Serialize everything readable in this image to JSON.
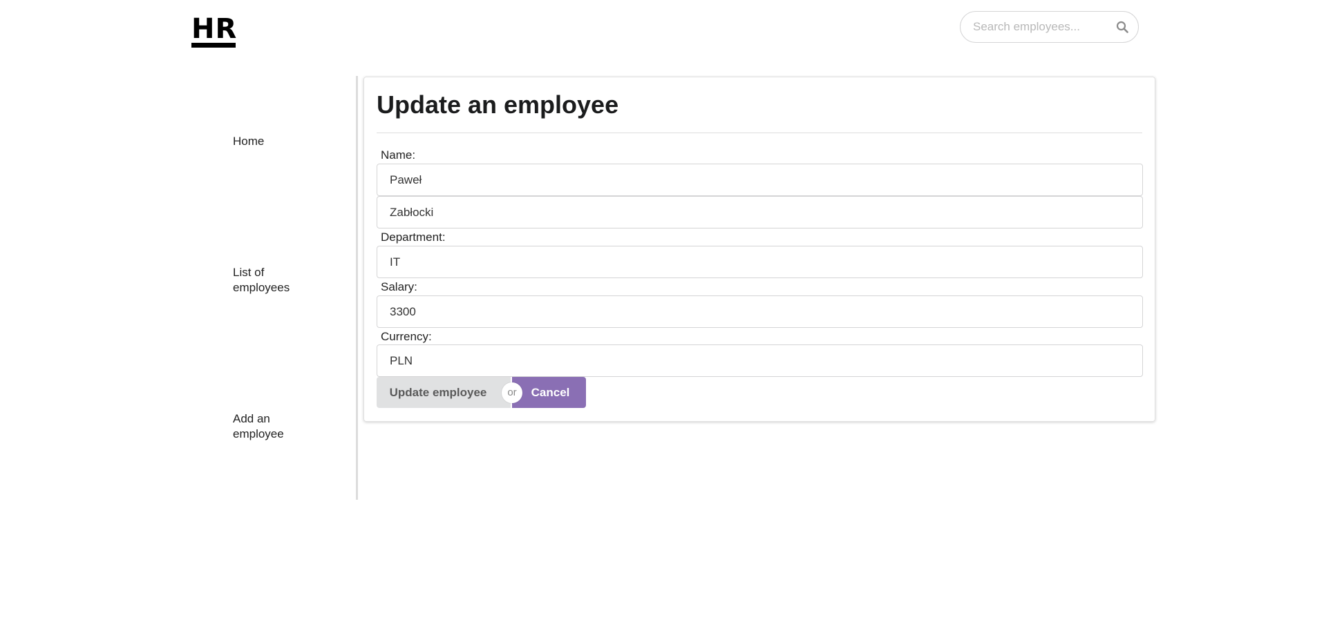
{
  "header": {
    "logo_text": "HR",
    "search_placeholder": "Search employees..."
  },
  "sidebar": {
    "items": [
      {
        "label": "Home"
      },
      {
        "label": "List of employees"
      },
      {
        "label": "Add an employee"
      }
    ]
  },
  "form": {
    "title": "Update an employee",
    "name_label": "Name:",
    "first_name": "Paweł",
    "last_name": "Zabłocki",
    "department_label": "Department:",
    "department": "IT",
    "salary_label": "Salary:",
    "salary": "3300",
    "currency_label": "Currency:",
    "currency": "PLN",
    "submit_label": "Update employee",
    "or_label": "or",
    "cancel_label": "Cancel"
  },
  "colors": {
    "cancel_button": "#8a6fb4",
    "update_button": "#e0e1e2"
  },
  "icons": {
    "search": "search-icon"
  }
}
